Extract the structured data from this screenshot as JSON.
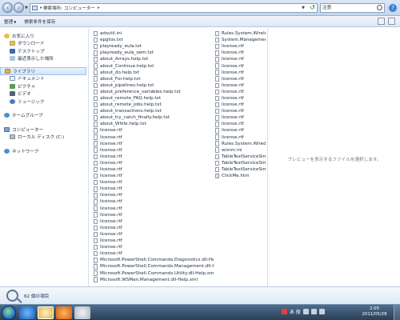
{
  "address": {
    "crumbs": [
      "検索場所: コンピューター"
    ],
    "search_value": "注意"
  },
  "toolbar": {
    "organize_label": "整理",
    "save_search_label": "検索条件を保存"
  },
  "navigation": {
    "favorites": {
      "label": "お気に入り",
      "items": [
        "ダウンロード",
        "デスクトップ",
        "最近表示した場所"
      ]
    },
    "libraries": {
      "label": "ライブラリ",
      "items": [
        "ドキュメント",
        "ピクチャ",
        "ビデオ",
        "ミュージック"
      ]
    },
    "homegroup": {
      "label": "ホームグループ"
    },
    "computer": {
      "label": "コンピューター",
      "items": [
        "ローカル ディスク (C:)"
      ]
    },
    "network": {
      "label": "ネットワーク"
    }
  },
  "files": {
    "column1": [
      "adsutil.ini",
      "epgtos.txt",
      "playready_eula.txt",
      "playready_eula_oem.txt",
      "about_Arrays.help.txt",
      "about_Continue.help.txt",
      "about_do.help.txt",
      "about_For.help.txt",
      "about_pipelines.help.txt",
      "about_preference_variables.help.txt",
      "about_remote_FAQ.help.txt",
      "about_remote_jobs.help.txt",
      "about_transactions.help.txt",
      "about_try_catch_finally.help.txt",
      "about_While.help.txt",
      "license.rtf",
      "license.rtf",
      "license.rtf",
      "license.rtf",
      "license.rtf",
      "license.rtf",
      "license.rtf",
      "license.rtf",
      "license.rtf",
      "license.rtf",
      "license.rtf",
      "license.rtf",
      "license.rtf",
      "license.rtf",
      "license.rtf",
      "license.rtf",
      "license.rtf",
      "license.rtf",
      "license.rtf",
      "license.rtf",
      "Microsoft.PowerShell.Commands.Diagnostics.dll-Help.xml",
      "Microsoft.PowerShell.Commands.Management.dll-Help.xml",
      "Microsoft.PowerShell.Commands.Utility.dll-Help.xml",
      "Microsoft.WSMan.Management.dll-Help.xml"
    ],
    "column2": [
      "Rules.System.Wireless.xm",
      "System.Management.Auto",
      "license.rtf",
      "license.rtf",
      "license.rtf",
      "license.rtf",
      "license.rtf",
      "license.rtf",
      "license.rtf",
      "license.rtf",
      "license.rtf",
      "license.rtf",
      "license.rtf",
      "license.rtf",
      "license.rtf",
      "license.rtf",
      "license.rtf",
      "Rules.System.Wired.xml",
      "wnnm.ini",
      "TableTextServiceSimplifie",
      "TableTextServiceSimplifie",
      "TableTextServiceSimplifie",
      "ClickMe.htm"
    ]
  },
  "preview": {
    "message": "プレビューを表示するファイルを選択します。"
  },
  "details": {
    "count_text": "62 個の項目"
  },
  "taskbar": {
    "tray_text": "あ 般",
    "time": "2:05",
    "date": "2011/05/28"
  }
}
